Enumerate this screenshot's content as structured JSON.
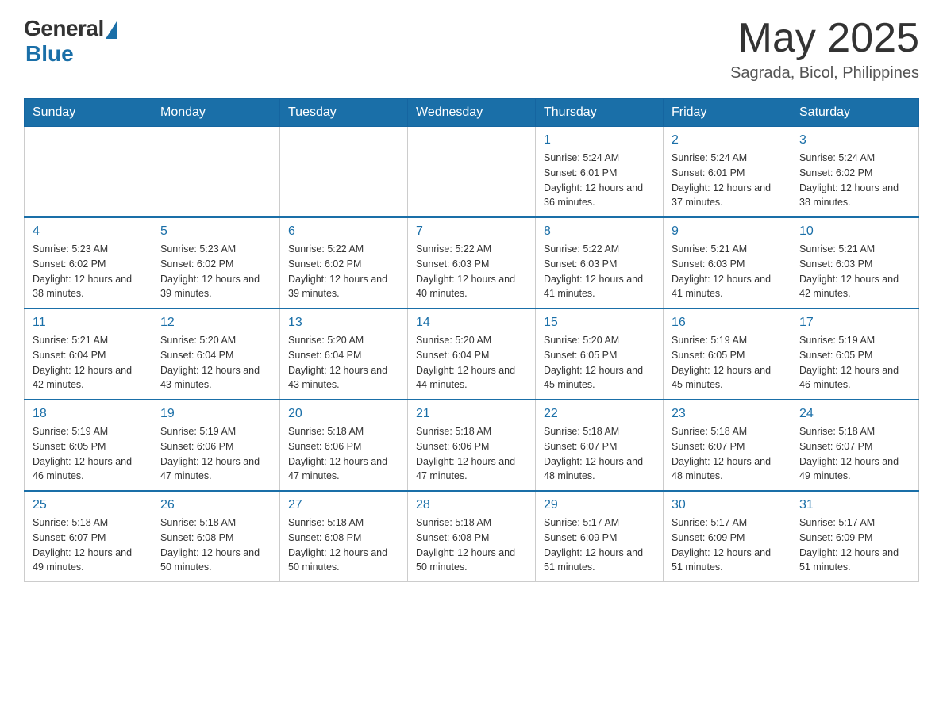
{
  "header": {
    "logo_general": "General",
    "logo_blue": "Blue",
    "month_year": "May 2025",
    "location": "Sagrada, Bicol, Philippines"
  },
  "days_of_week": [
    "Sunday",
    "Monday",
    "Tuesday",
    "Wednesday",
    "Thursday",
    "Friday",
    "Saturday"
  ],
  "weeks": [
    [
      {
        "day": "",
        "sunrise": "",
        "sunset": "",
        "daylight": ""
      },
      {
        "day": "",
        "sunrise": "",
        "sunset": "",
        "daylight": ""
      },
      {
        "day": "",
        "sunrise": "",
        "sunset": "",
        "daylight": ""
      },
      {
        "day": "",
        "sunrise": "",
        "sunset": "",
        "daylight": ""
      },
      {
        "day": "1",
        "sunrise": "Sunrise: 5:24 AM",
        "sunset": "Sunset: 6:01 PM",
        "daylight": "Daylight: 12 hours and 36 minutes."
      },
      {
        "day": "2",
        "sunrise": "Sunrise: 5:24 AM",
        "sunset": "Sunset: 6:01 PM",
        "daylight": "Daylight: 12 hours and 37 minutes."
      },
      {
        "day": "3",
        "sunrise": "Sunrise: 5:24 AM",
        "sunset": "Sunset: 6:02 PM",
        "daylight": "Daylight: 12 hours and 38 minutes."
      }
    ],
    [
      {
        "day": "4",
        "sunrise": "Sunrise: 5:23 AM",
        "sunset": "Sunset: 6:02 PM",
        "daylight": "Daylight: 12 hours and 38 minutes."
      },
      {
        "day": "5",
        "sunrise": "Sunrise: 5:23 AM",
        "sunset": "Sunset: 6:02 PM",
        "daylight": "Daylight: 12 hours and 39 minutes."
      },
      {
        "day": "6",
        "sunrise": "Sunrise: 5:22 AM",
        "sunset": "Sunset: 6:02 PM",
        "daylight": "Daylight: 12 hours and 39 minutes."
      },
      {
        "day": "7",
        "sunrise": "Sunrise: 5:22 AM",
        "sunset": "Sunset: 6:03 PM",
        "daylight": "Daylight: 12 hours and 40 minutes."
      },
      {
        "day": "8",
        "sunrise": "Sunrise: 5:22 AM",
        "sunset": "Sunset: 6:03 PM",
        "daylight": "Daylight: 12 hours and 41 minutes."
      },
      {
        "day": "9",
        "sunrise": "Sunrise: 5:21 AM",
        "sunset": "Sunset: 6:03 PM",
        "daylight": "Daylight: 12 hours and 41 minutes."
      },
      {
        "day": "10",
        "sunrise": "Sunrise: 5:21 AM",
        "sunset": "Sunset: 6:03 PM",
        "daylight": "Daylight: 12 hours and 42 minutes."
      }
    ],
    [
      {
        "day": "11",
        "sunrise": "Sunrise: 5:21 AM",
        "sunset": "Sunset: 6:04 PM",
        "daylight": "Daylight: 12 hours and 42 minutes."
      },
      {
        "day": "12",
        "sunrise": "Sunrise: 5:20 AM",
        "sunset": "Sunset: 6:04 PM",
        "daylight": "Daylight: 12 hours and 43 minutes."
      },
      {
        "day": "13",
        "sunrise": "Sunrise: 5:20 AM",
        "sunset": "Sunset: 6:04 PM",
        "daylight": "Daylight: 12 hours and 43 minutes."
      },
      {
        "day": "14",
        "sunrise": "Sunrise: 5:20 AM",
        "sunset": "Sunset: 6:04 PM",
        "daylight": "Daylight: 12 hours and 44 minutes."
      },
      {
        "day": "15",
        "sunrise": "Sunrise: 5:20 AM",
        "sunset": "Sunset: 6:05 PM",
        "daylight": "Daylight: 12 hours and 45 minutes."
      },
      {
        "day": "16",
        "sunrise": "Sunrise: 5:19 AM",
        "sunset": "Sunset: 6:05 PM",
        "daylight": "Daylight: 12 hours and 45 minutes."
      },
      {
        "day": "17",
        "sunrise": "Sunrise: 5:19 AM",
        "sunset": "Sunset: 6:05 PM",
        "daylight": "Daylight: 12 hours and 46 minutes."
      }
    ],
    [
      {
        "day": "18",
        "sunrise": "Sunrise: 5:19 AM",
        "sunset": "Sunset: 6:05 PM",
        "daylight": "Daylight: 12 hours and 46 minutes."
      },
      {
        "day": "19",
        "sunrise": "Sunrise: 5:19 AM",
        "sunset": "Sunset: 6:06 PM",
        "daylight": "Daylight: 12 hours and 47 minutes."
      },
      {
        "day": "20",
        "sunrise": "Sunrise: 5:18 AM",
        "sunset": "Sunset: 6:06 PM",
        "daylight": "Daylight: 12 hours and 47 minutes."
      },
      {
        "day": "21",
        "sunrise": "Sunrise: 5:18 AM",
        "sunset": "Sunset: 6:06 PM",
        "daylight": "Daylight: 12 hours and 47 minutes."
      },
      {
        "day": "22",
        "sunrise": "Sunrise: 5:18 AM",
        "sunset": "Sunset: 6:07 PM",
        "daylight": "Daylight: 12 hours and 48 minutes."
      },
      {
        "day": "23",
        "sunrise": "Sunrise: 5:18 AM",
        "sunset": "Sunset: 6:07 PM",
        "daylight": "Daylight: 12 hours and 48 minutes."
      },
      {
        "day": "24",
        "sunrise": "Sunrise: 5:18 AM",
        "sunset": "Sunset: 6:07 PM",
        "daylight": "Daylight: 12 hours and 49 minutes."
      }
    ],
    [
      {
        "day": "25",
        "sunrise": "Sunrise: 5:18 AM",
        "sunset": "Sunset: 6:07 PM",
        "daylight": "Daylight: 12 hours and 49 minutes."
      },
      {
        "day": "26",
        "sunrise": "Sunrise: 5:18 AM",
        "sunset": "Sunset: 6:08 PM",
        "daylight": "Daylight: 12 hours and 50 minutes."
      },
      {
        "day": "27",
        "sunrise": "Sunrise: 5:18 AM",
        "sunset": "Sunset: 6:08 PM",
        "daylight": "Daylight: 12 hours and 50 minutes."
      },
      {
        "day": "28",
        "sunrise": "Sunrise: 5:18 AM",
        "sunset": "Sunset: 6:08 PM",
        "daylight": "Daylight: 12 hours and 50 minutes."
      },
      {
        "day": "29",
        "sunrise": "Sunrise: 5:17 AM",
        "sunset": "Sunset: 6:09 PM",
        "daylight": "Daylight: 12 hours and 51 minutes."
      },
      {
        "day": "30",
        "sunrise": "Sunrise: 5:17 AM",
        "sunset": "Sunset: 6:09 PM",
        "daylight": "Daylight: 12 hours and 51 minutes."
      },
      {
        "day": "31",
        "sunrise": "Sunrise: 5:17 AM",
        "sunset": "Sunset: 6:09 PM",
        "daylight": "Daylight: 12 hours and 51 minutes."
      }
    ]
  ]
}
